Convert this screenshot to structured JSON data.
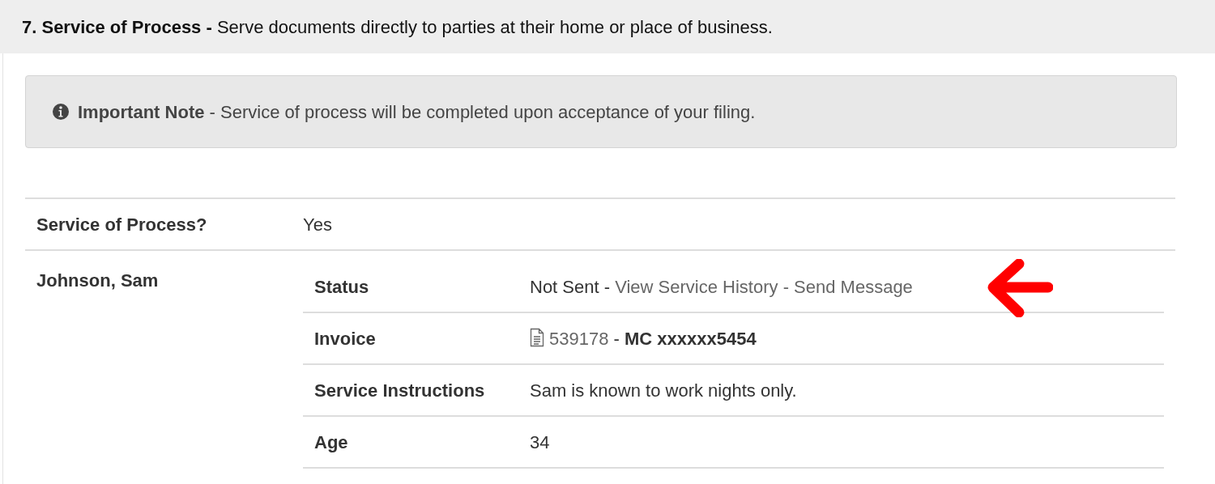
{
  "section": {
    "heading": "**7. Service of Process -** Serve documents directly to parties at their home or place of business."
  },
  "note": {
    "text": "**Important Note** - Service of process will be completed upon acceptance of your filing."
  },
  "rows": [
    {
      "label": "Service of Process?",
      "value": "Yes"
    },
    {
      "label": "Johnson, Sam",
      "details": [
        {
          "label": "Status",
          "parts": [
            {
              "kind": "text",
              "text": "Not Sent"
            },
            {
              "kind": "text",
              "text": "-"
            },
            {
              "kind": "link",
              "text": "View Service History"
            },
            {
              "kind": "link",
              "text": "-"
            },
            {
              "kind": "link",
              "text": "Send Message"
            }
          ]
        },
        {
          "label": "Invoice",
          "parts": [
            {
              "kind": "document-icon"
            },
            {
              "kind": "link",
              "text": "539178"
            },
            {
              "kind": "text",
              "text": "-"
            },
            {
              "kind": "bold",
              "text": "MC xxxxxx5454"
            }
          ]
        },
        {
          "label": "Service Instructions",
          "parts": [
            {
              "kind": "text",
              "text": "Sam is known to work nights only."
            }
          ]
        },
        {
          "label": "Age",
          "parts": [
            {
              "kind": "text",
              "text": "34"
            }
          ]
        }
      ]
    }
  ]
}
